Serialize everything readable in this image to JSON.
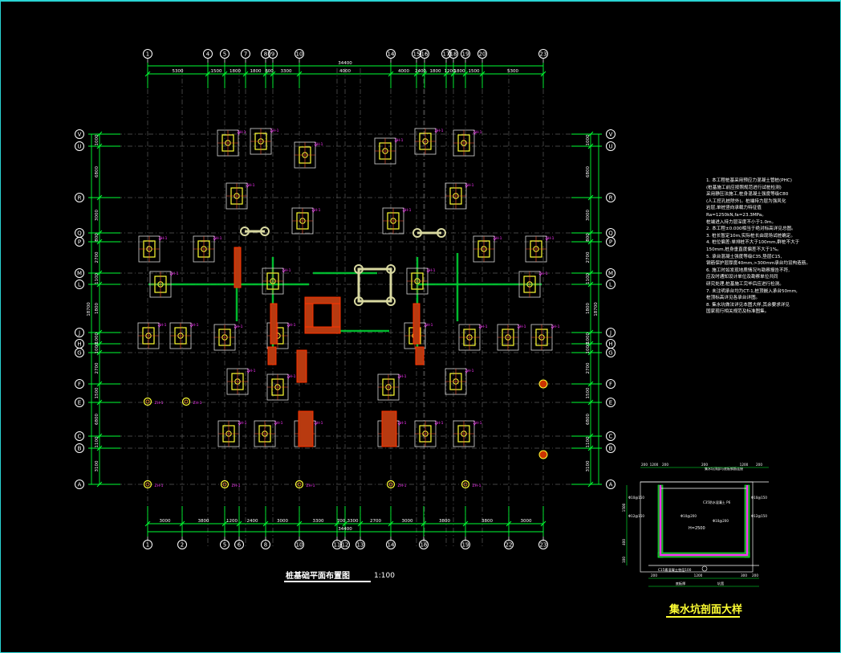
{
  "drawing": {
    "plan_title": "桩基础平面布置图",
    "plan_scale": "1:100",
    "detail_title": "集水坑剖面大样",
    "overall_dim": "34400",
    "colors": {
      "background": "#000000",
      "grid": "#00ff33",
      "axis_bubble": "#ffffff",
      "annotation": "#ff33ff",
      "column": "#ff3300",
      "highlight": "#ffff33"
    }
  },
  "axes": {
    "top": [
      "1",
      "4",
      "5",
      "7",
      "8",
      "9",
      "10",
      "14",
      "15",
      "16",
      "17",
      "18",
      "19",
      "20",
      "23"
    ],
    "bottom": [
      "1",
      "2",
      "5",
      "6",
      "8",
      "10",
      "11",
      "12",
      "13",
      "14",
      "16",
      "19",
      "22",
      "23"
    ],
    "left": [
      "V",
      "U",
      "R",
      "Q",
      "P",
      "M",
      "L",
      "J",
      "H",
      "G",
      "F",
      "E",
      "C",
      "B",
      "A"
    ],
    "right": [
      "V",
      "U",
      "R",
      "Q",
      "P",
      "M",
      "L",
      "J",
      "H",
      "G",
      "F",
      "E",
      "C",
      "B",
      "A"
    ]
  },
  "dims": {
    "top": [
      "5300",
      "1500",
      "1800",
      "1800",
      "800",
      "3300",
      "4000",
      "4000",
      "2400",
      "1800",
      "1200",
      "1800",
      "1500",
      "5300"
    ],
    "bottom": [
      "3000",
      "3800",
      "1200",
      "2400",
      "3000",
      "3300",
      "700",
      "3300",
      "2700",
      "3000",
      "3800",
      "3800",
      "3000"
    ],
    "left": [
      "1000",
      "6800",
      "3000",
      "800",
      "2700",
      "1100",
      "1800",
      "1000",
      "1000",
      "2700",
      "1500",
      "6800",
      "1100",
      "3100"
    ],
    "right": [
      "1000",
      "6800",
      "3000",
      "800",
      "2700",
      "1100",
      "1800",
      "1000",
      "1000",
      "2700",
      "1500",
      "6800",
      "1100",
      "3100"
    ],
    "left_total": "18700",
    "right_total": "18700"
  },
  "notes": [
    "1. 本工程桩基采用预应力混凝土管桩(PHC)",
    "(桩基施工前应按照规范进行试桩检测)",
    "采用静压法施工,桩身混凝土强度等级C80",
    "(人工挖孔桩除外)。桩端持力层为强风化",
    "岩层,单桩竖向承载力特征值Ra=1250kN,fa=23.3MPa。",
    "桩端进入持力层深度不小于1.0m。",
    "2. 本工程±0.000相当于绝对标高详见总图。",
    "3. 桩长暂定10m,实际桩长由现场试桩确定。",
    "4. 桩位偏差:单排桩不大于100mm,群桩不大于",
    "150mm,桩身垂直度偏差不大于1%。",
    "5. 承台混凝土强度等级C35,垫层C15,",
    "钢筋保护层厚度40mm,>300mm承台均设构造筋。",
    "6. 施工时如发现地质情况与勘察报告不符,",
    "应及时通知设计单位及勘察单位共同",
    "研究处理,桩基施工完毕后应进行检测。",
    "7. 未注明承台均为CT-1,桩顶嵌入承台50mm,",
    "桩顶标高详见各承台详图。",
    "8. 集水坑做法详见本图大样,其余要求详见",
    "国家现行相关规范及标准图集。"
  ],
  "pile_label": "ZH-1",
  "detail": {
    "dims_top": [
      "200",
      "1200",
      "200",
      "200",
      "1200",
      "200"
    ],
    "dims_bottom": [
      "200",
      "1200",
      "300",
      "200"
    ],
    "dims_left": [
      "1500",
      "400",
      "100"
    ],
    "depth_label": "H=2500",
    "base_label": "C15素混凝土垫层100",
    "bar_labels": [
      "Φ10@150",
      "Φ10@150",
      "Φ12@150",
      "Φ12@150",
      "Φ10@200",
      "Φ10@200"
    ],
    "note_top": "集水坑顶部与底板钢筋连接",
    "note_mid": "C35防水混凝土 P6",
    "bottom_labels": [
      "底板厚",
      "坑宽"
    ]
  }
}
